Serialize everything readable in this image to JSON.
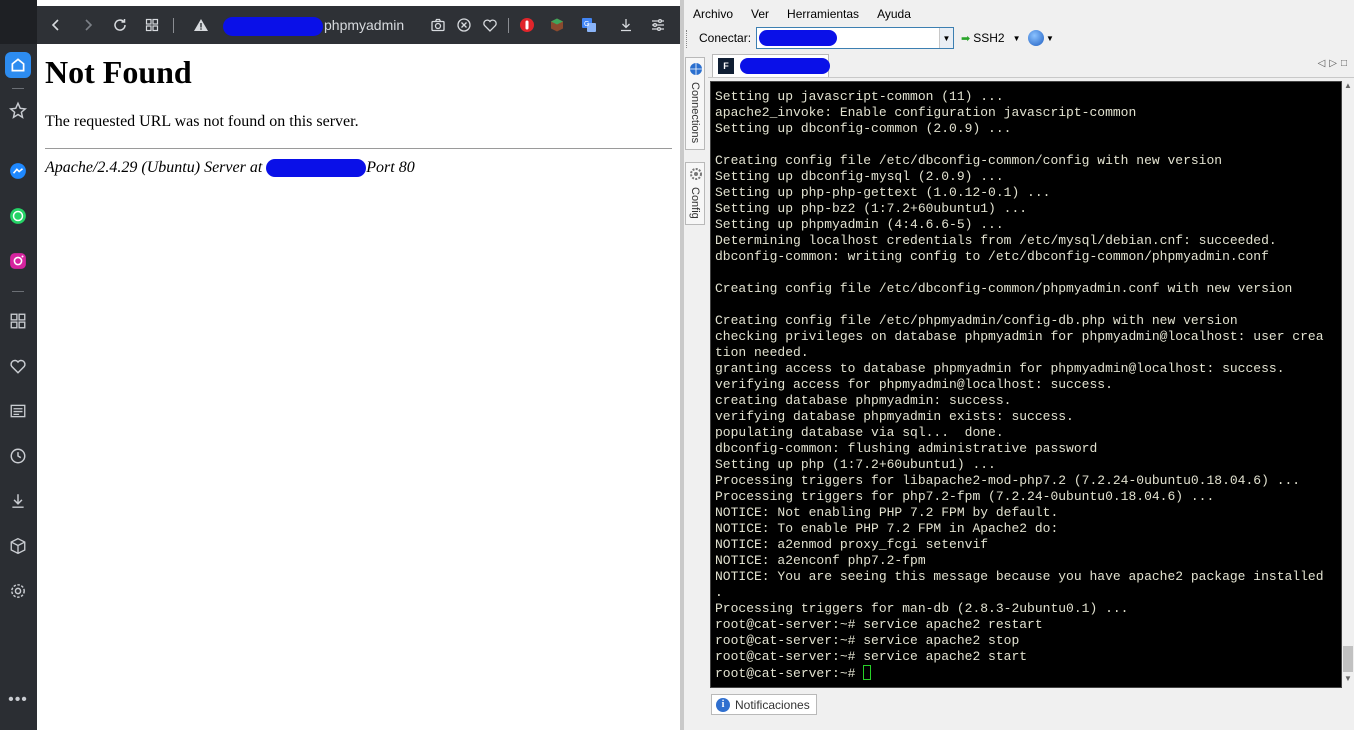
{
  "sidebar": {
    "icons": [
      "home-icon",
      "bookmarks-icon",
      "messenger-icon",
      "whatsapp-icon",
      "instagram-icon",
      "apps-icon",
      "favorites-icon",
      "news-icon",
      "history-icon",
      "downloads-icon",
      "extensions-icon",
      "settings-icon",
      "more-icon"
    ],
    "brand_colors": {
      "home": "#2d8cf0",
      "messenger": "#1e88ff",
      "whatsapp": "#25d366",
      "instagram": "#d6249f"
    }
  },
  "browser": {
    "url_text": "phpmyadmin",
    "page": {
      "heading": "Not Found",
      "message": "The requested URL was not found on this server.",
      "address_prefix": "Apache/2.4.29 (Ubuntu) Server at ",
      "address_suffix": "Port 80"
    }
  },
  "crt": {
    "menu": [
      "Archivo",
      "Ver",
      "Herramientas",
      "Ayuda"
    ],
    "connect_label": "Conectar:",
    "protocol": "SSH2",
    "side_tabs": [
      "Connections",
      "Config"
    ],
    "status_tab": "Notificaciones",
    "terminal_lines": [
      "Setting up javascript-common (11) ...",
      "apache2_invoke: Enable configuration javascript-common",
      "Setting up dbconfig-common (2.0.9) ...",
      "",
      "Creating config file /etc/dbconfig-common/config with new version",
      "Setting up dbconfig-mysql (2.0.9) ...",
      "Setting up php-php-gettext (1.0.12-0.1) ...",
      "Setting up php-bz2 (1:7.2+60ubuntu1) ...",
      "Setting up phpmyadmin (4:4.6.6-5) ...",
      "Determining localhost credentials from /etc/mysql/debian.cnf: succeeded.",
      "dbconfig-common: writing config to /etc/dbconfig-common/phpmyadmin.conf",
      "",
      "Creating config file /etc/dbconfig-common/phpmyadmin.conf with new version",
      "",
      "Creating config file /etc/phpmyadmin/config-db.php with new version",
      "checking privileges on database phpmyadmin for phpmyadmin@localhost: user crea",
      "tion needed.",
      "granting access to database phpmyadmin for phpmyadmin@localhost: success.",
      "verifying access for phpmyadmin@localhost: success.",
      "creating database phpmyadmin: success.",
      "verifying database phpmyadmin exists: success.",
      "populating database via sql...  done.",
      "dbconfig-common: flushing administrative password",
      "Setting up php (1:7.2+60ubuntu1) ...",
      "Processing triggers for libapache2-mod-php7.2 (7.2.24-0ubuntu0.18.04.6) ...",
      "Processing triggers for php7.2-fpm (7.2.24-0ubuntu0.18.04.6) ...",
      "NOTICE: Not enabling PHP 7.2 FPM by default.",
      "NOTICE: To enable PHP 7.2 FPM in Apache2 do:",
      "NOTICE: a2enmod proxy_fcgi setenvif",
      "NOTICE: a2enconf php7.2-fpm",
      "NOTICE: You are seeing this message because you have apache2 package installed",
      ".",
      "Processing triggers for man-db (2.8.3-2ubuntu0.1) ...",
      "root@cat-server:~# service apache2 restart",
      "root@cat-server:~# service apache2 stop",
      "root@cat-server:~# service apache2 start"
    ],
    "prompt": "root@cat-server:~# "
  }
}
